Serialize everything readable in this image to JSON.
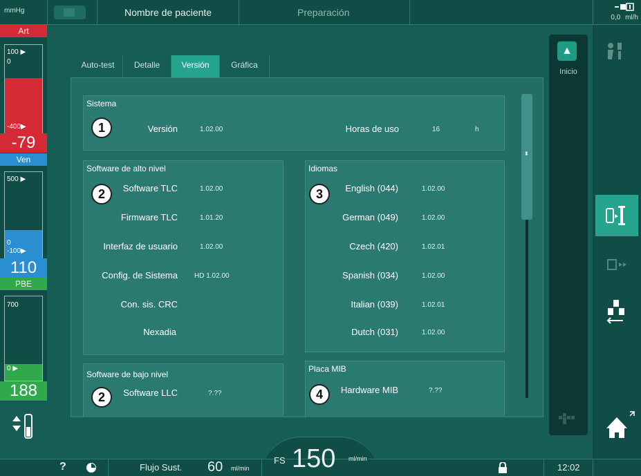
{
  "topbar": {
    "unit": "mmHg",
    "patient_name": "Nombre de paciente",
    "phase": "Preparación",
    "rate_value": "0,0",
    "rate_unit": "ml/h"
  },
  "pressures": {
    "art": {
      "label": "Art",
      "top_tick": "100",
      "zero_tick": "0",
      "bottom_tick": "-400",
      "value": "-79"
    },
    "ven": {
      "label": "Ven",
      "top_tick": "500",
      "zero_tick": "0",
      "bottom_tick": "-100",
      "value": "110"
    },
    "pbe": {
      "label": "PBE",
      "top_tick": "700",
      "zero_tick": "0",
      "value": "188"
    }
  },
  "tabs": [
    {
      "label": "Auto-test",
      "active": false
    },
    {
      "label": "Detalle",
      "active": false
    },
    {
      "label": "Versión",
      "active": true
    },
    {
      "label": "Gráfica",
      "active": false
    }
  ],
  "sistema": {
    "title": "Sistema",
    "version_label": "Versión",
    "version_value": "1.02.00",
    "hours_label": "Horas de uso",
    "hours_value": "16",
    "hours_unit": "h"
  },
  "alto_nivel": {
    "title": "Software de alto nivel",
    "rows": [
      {
        "label": "Software TLC",
        "value": "1.02.00"
      },
      {
        "label": "Firmware TLC",
        "value": "1.01.20"
      },
      {
        "label": "Interfaz de usuario",
        "value": "1.02.00"
      },
      {
        "label": "Config. de Sistema",
        "value": "HD 1.02.00"
      },
      {
        "label": "Con. sis. CRC",
        "value": ""
      },
      {
        "label": "Nexadia",
        "value": ""
      }
    ]
  },
  "idiomas": {
    "title": "Idiomas",
    "rows": [
      {
        "label": "English (044)",
        "value": "1.02.00"
      },
      {
        "label": "German (049)",
        "value": "1.02.00"
      },
      {
        "label": "Czech (420)",
        "value": "1.02.01"
      },
      {
        "label": "Spanish (034)",
        "value": "1.02.00"
      },
      {
        "label": "Italian (039)",
        "value": "1.02.01"
      },
      {
        "label": "Dutch (031)",
        "value": "1.02.00"
      }
    ]
  },
  "bajo_nivel": {
    "title": "Software de bajo nivel",
    "rows": [
      {
        "label": "Software LLC",
        "value": "?.??"
      }
    ]
  },
  "placa_mib": {
    "title": "Placa MIB",
    "rows": [
      {
        "label": "Hardware MIB",
        "value": "?.??"
      }
    ]
  },
  "badges": [
    "1",
    "2",
    "3",
    "2",
    "4"
  ],
  "strip": {
    "inicio_label": "Inicio"
  },
  "bottombar": {
    "help": "?",
    "flow_label": "Flujo Sust.",
    "flow_value": "60",
    "flow_unit": "ml/min",
    "fs_label": "FS",
    "fs_value": "150",
    "fs_unit": "ml/min",
    "time": "12:02"
  },
  "colors": {
    "accent": "#25a48e",
    "art_red": "#d42a35",
    "ven_blue": "#2a8fd2",
    "pbe_green": "#2fa94a"
  }
}
